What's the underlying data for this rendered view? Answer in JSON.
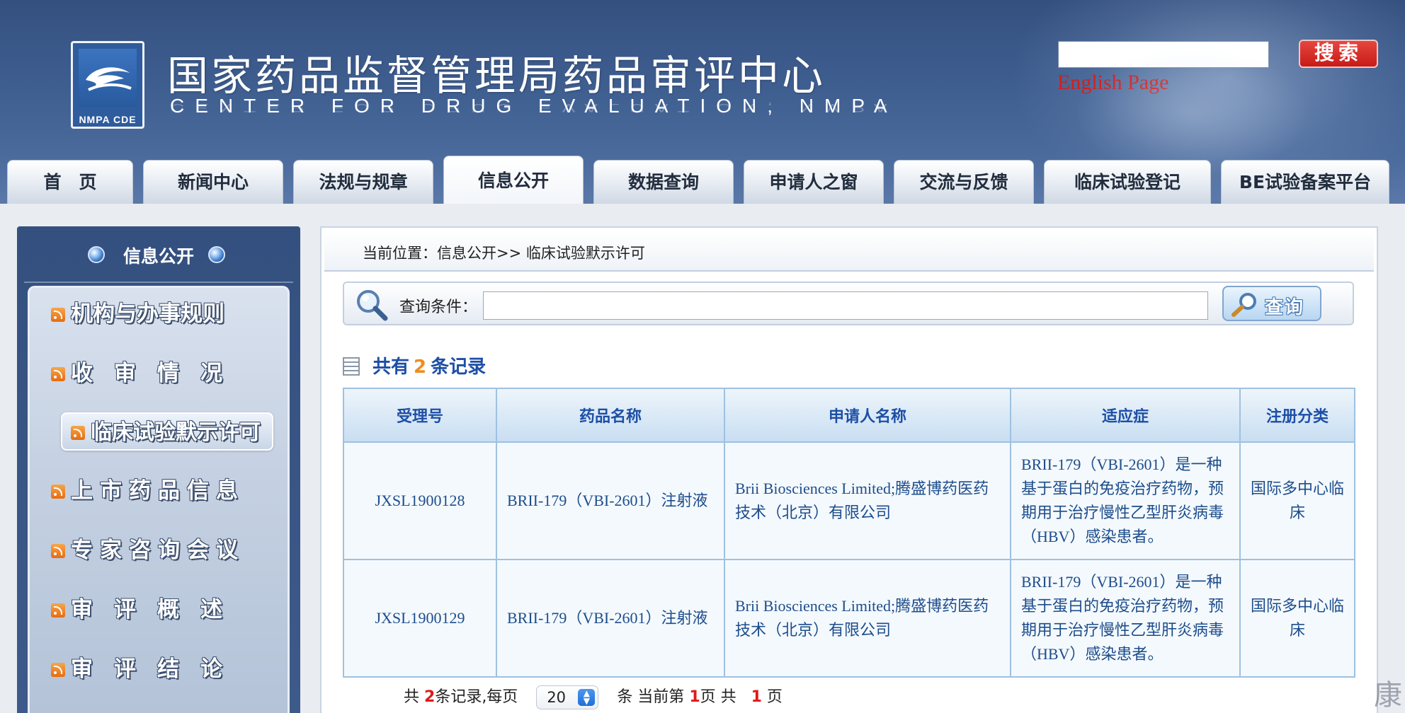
{
  "header": {
    "logo_abbr": "NMPA CDE",
    "title_cn": "国家药品监督管理局药品审评中心",
    "title_en": "CENTER FOR DRUG EVALUATION, NMPA",
    "search_placeholder": "",
    "search_button": "搜索",
    "english_link": "English Page"
  },
  "nav": [
    {
      "label": "首　页"
    },
    {
      "label": "新闻中心"
    },
    {
      "label": "法规与规章"
    },
    {
      "label": "信息公开"
    },
    {
      "label": "数据查询"
    },
    {
      "label": "申请人之窗"
    },
    {
      "label": "交流与反馈"
    },
    {
      "label": "临床试验登记"
    },
    {
      "label": "BE试验备案平台"
    }
  ],
  "sidebar": {
    "title": "信息公开",
    "items": [
      {
        "label": "机构与办事规则"
      },
      {
        "label": "收审情况"
      },
      {
        "label": "临床试验默示许可"
      },
      {
        "label": "上市药品信息"
      },
      {
        "label": "专家咨询会议"
      },
      {
        "label": "审评概述"
      },
      {
        "label": "审评结论"
      }
    ]
  },
  "main": {
    "breadcrumb": "当前位置：信息公开>> 临床试验默示许可",
    "query_label": "查询条件：",
    "query_value": "",
    "query_button": "查询",
    "record_prefix": "共有",
    "record_count": "2",
    "record_suffix": "条记录",
    "table": {
      "headers": [
        "受理号",
        "药品名称",
        "申请人名称",
        "适应症",
        "注册分类"
      ],
      "rows": [
        [
          "JXSL1900128",
          "BRII-179（VBI-2601）注射液",
          "Brii Biosciences Limited;腾盛博药医药技术（北京）有限公司",
          "BRII-179（VBI-2601）是一种基于蛋白的免疫治疗药物，预期用于治疗慢性乙型肝炎病毒（HBV）感染患者。",
          "国际多中心临床"
        ],
        [
          "JXSL1900129",
          "BRII-179（VBI-2601）注射液",
          "Brii Biosciences Limited;腾盛博药医药技术（北京）有限公司",
          "BRII-179（VBI-2601）是一种基于蛋白的免疫治疗药物，预期用于治疗慢性乙型肝炎病毒（HBV）感染患者。",
          "国际多中心临床"
        ]
      ]
    },
    "pagination": {
      "total_prefix": "共 ",
      "total": "2",
      "total_suffix": "条记录,每页",
      "per_page": "20",
      "current_prefix": "条 当前第 ",
      "current": "1",
      "pages_prefix": "页 共 ",
      "pages": "1",
      "pages_suffix": " 页"
    }
  },
  "watermark": "康"
}
